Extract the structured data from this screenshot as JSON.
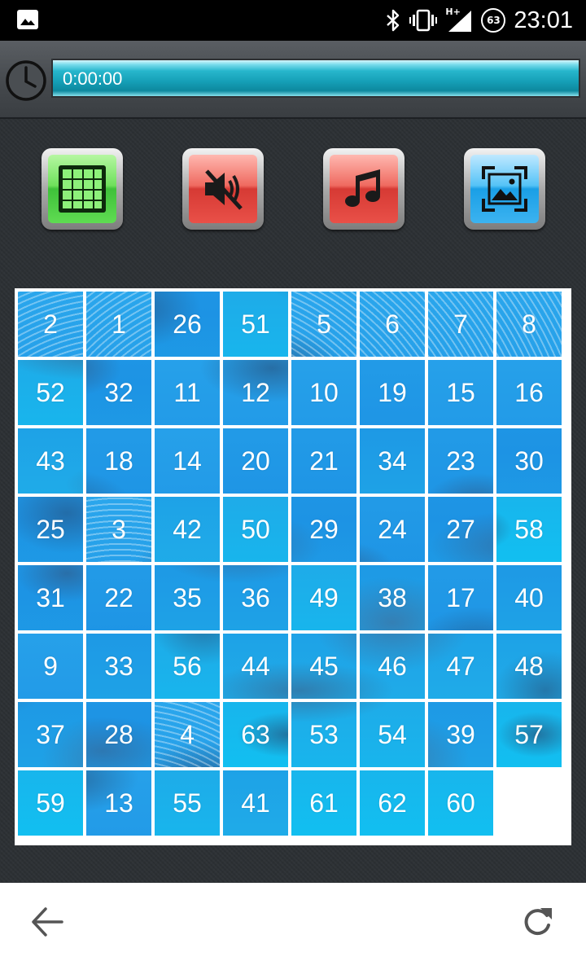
{
  "status_bar": {
    "left_icon": "image-icon",
    "icons": [
      "bluetooth-icon",
      "vibrate-icon",
      "signal-icon"
    ],
    "network_type": "H+",
    "battery_level": "63",
    "time": "23:01"
  },
  "timer": {
    "icon": "clock-icon",
    "value": "0:00:00",
    "progress_fraction": 1.0
  },
  "toolbar": {
    "grid_button": {
      "icon": "grid-icon",
      "color": "#3fc13a"
    },
    "mute_button": {
      "icon": "mute-icon",
      "color": "#d63a34"
    },
    "music_button": {
      "icon": "music-note-icon",
      "color": "#d63a34"
    },
    "image_button": {
      "icon": "image-preview-icon",
      "color": "#1a9fe6"
    }
  },
  "puzzle": {
    "grid_size": 8,
    "tiles": [
      [
        2,
        1,
        26,
        51,
        5,
        6,
        7,
        8
      ],
      [
        52,
        32,
        11,
        12,
        10,
        19,
        15,
        16
      ],
      [
        43,
        18,
        14,
        20,
        21,
        34,
        23,
        30
      ],
      [
        25,
        3,
        42,
        50,
        29,
        24,
        27,
        58
      ],
      [
        31,
        22,
        35,
        36,
        49,
        38,
        17,
        40
      ],
      [
        9,
        33,
        56,
        44,
        45,
        46,
        47,
        48
      ],
      [
        37,
        28,
        4,
        63,
        53,
        54,
        39,
        57
      ],
      [
        59,
        13,
        55,
        41,
        61,
        62,
        60,
        null
      ]
    ]
  },
  "nav_bar": {
    "back_icon": "back-arrow-icon",
    "refresh_icon": "refresh-icon"
  },
  "colors": {
    "progress": "#159fb6",
    "water": "#1e9be6",
    "background": "#2c3034"
  }
}
